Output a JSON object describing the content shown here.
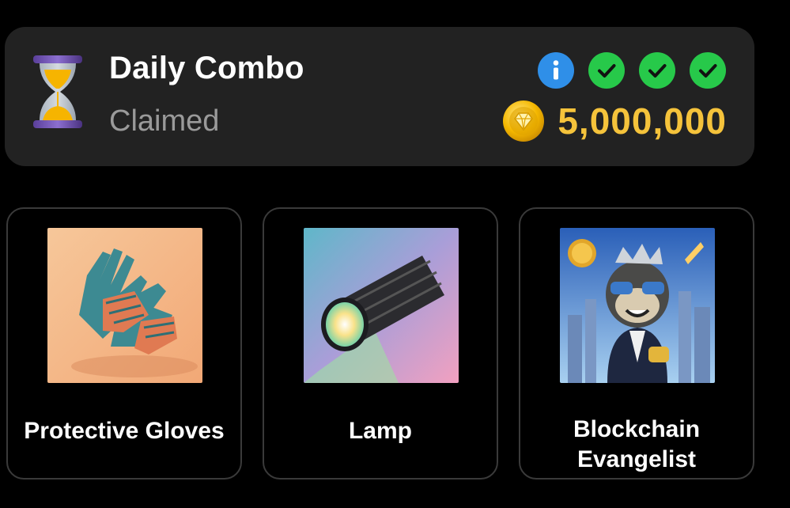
{
  "combo": {
    "title": "Daily Combo",
    "status": "Claimed",
    "reward_amount": "5,000,000",
    "indicators": [
      "info",
      "check",
      "check",
      "check"
    ]
  },
  "cards": [
    {
      "name": "Protective Gloves"
    },
    {
      "name": "Lamp"
    },
    {
      "name": "Blockchain Evangelist"
    }
  ],
  "colors": {
    "panel_bg": "#222222",
    "reward_gold": "#f5c33b",
    "info_blue": "#2f8fe8",
    "check_green": "#27c94a",
    "status_gray": "#9a9a9a"
  }
}
